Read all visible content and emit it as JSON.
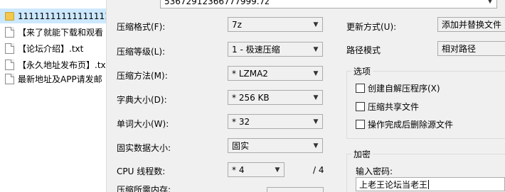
{
  "file_list": {
    "items": [
      {
        "name": "11111111111111111",
        "icon": "folder-icon",
        "selected": true
      },
      {
        "name": "【来了就能下载和观看",
        "icon": "text-file-icon"
      },
      {
        "name": "【论坛介绍】.txt",
        "icon": "text-file-icon"
      },
      {
        "name": "【永久地址发布页】.tx",
        "icon": "text-file-icon"
      },
      {
        "name": "最新地址及APP请发邮",
        "icon": "text-file-icon"
      }
    ]
  },
  "dialog": {
    "archive_name": "53672912366777999.7z",
    "format_label": "压缩格式(F):",
    "format_value": "7z",
    "level_label": "压缩等级(L):",
    "level_value": "1 - 极速压缩",
    "method_label": "压缩方法(M):",
    "method_value": "* LZMA2",
    "dict_label": "字典大小(D):",
    "dict_value": "* 256 KB",
    "word_label": "单词大小(W):",
    "word_value": "* 32",
    "solid_label": "固实数据大小:",
    "solid_value": "固实",
    "cpu_label": "CPU 线程数:",
    "cpu_value": "* 4",
    "cpu_total": "/ 4",
    "memory_label": "压缩所需内存:",
    "update_label": "更新方式(U):",
    "update_value": "添加并替换文件",
    "path_label": "路径模式",
    "path_value": "相对路径",
    "options_title": "选项",
    "opt_sfx": "创建自解压程序(X)",
    "opt_shared": "压缩共享文件",
    "opt_delete": "操作完成后删除源文件",
    "encrypt_title": "加密",
    "password_label": "输入密码:",
    "password_value": "上老王论坛当老王"
  }
}
